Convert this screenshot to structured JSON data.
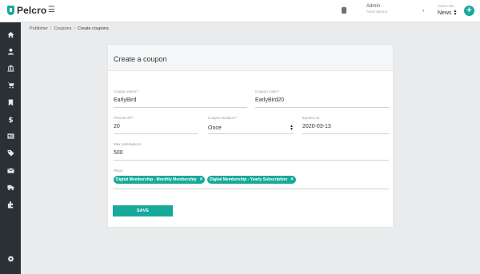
{
  "header": {
    "logo_text": "Pelcro",
    "user_name": "Admin",
    "user_role": "Administrator",
    "site_label": "Select site",
    "site_value": "News",
    "add_label": "+"
  },
  "breadcrumb": {
    "items": [
      "Publisher",
      "Coupons"
    ],
    "current": "Create coupons"
  },
  "form": {
    "title": "Create a coupon",
    "coupon_name": {
      "label": "Coupon name:*",
      "value": "EarlyBird"
    },
    "coupon_code": {
      "label": "Coupon code:*",
      "value": "EarlyBird20"
    },
    "percent_off": {
      "label": "Percent off:*",
      "value": "20"
    },
    "coupon_duration": {
      "label": "Coupon duration:*",
      "value": "Once"
    },
    "expires_on": {
      "label": "Expires on:",
      "value": "2020-03-13"
    },
    "max_redemptions": {
      "label": "Max redemptions",
      "value": "500"
    },
    "plans": {
      "label": "Plans",
      "chips": [
        "Digital Membership - Monthly Membership",
        "Digital Membership - Yearly Subscription"
      ]
    },
    "save_label": "SAVE"
  },
  "colors": {
    "accent": "#17a99a",
    "sidebar": "#2b3035"
  },
  "sidebar_icons": [
    "home-icon",
    "user-icon",
    "bank-icon",
    "cart-icon",
    "bookmark-icon",
    "dollar-icon",
    "newspaper-icon",
    "tag-icon",
    "mail-icon",
    "truck-icon",
    "puzzle-icon",
    "gear-icon"
  ]
}
